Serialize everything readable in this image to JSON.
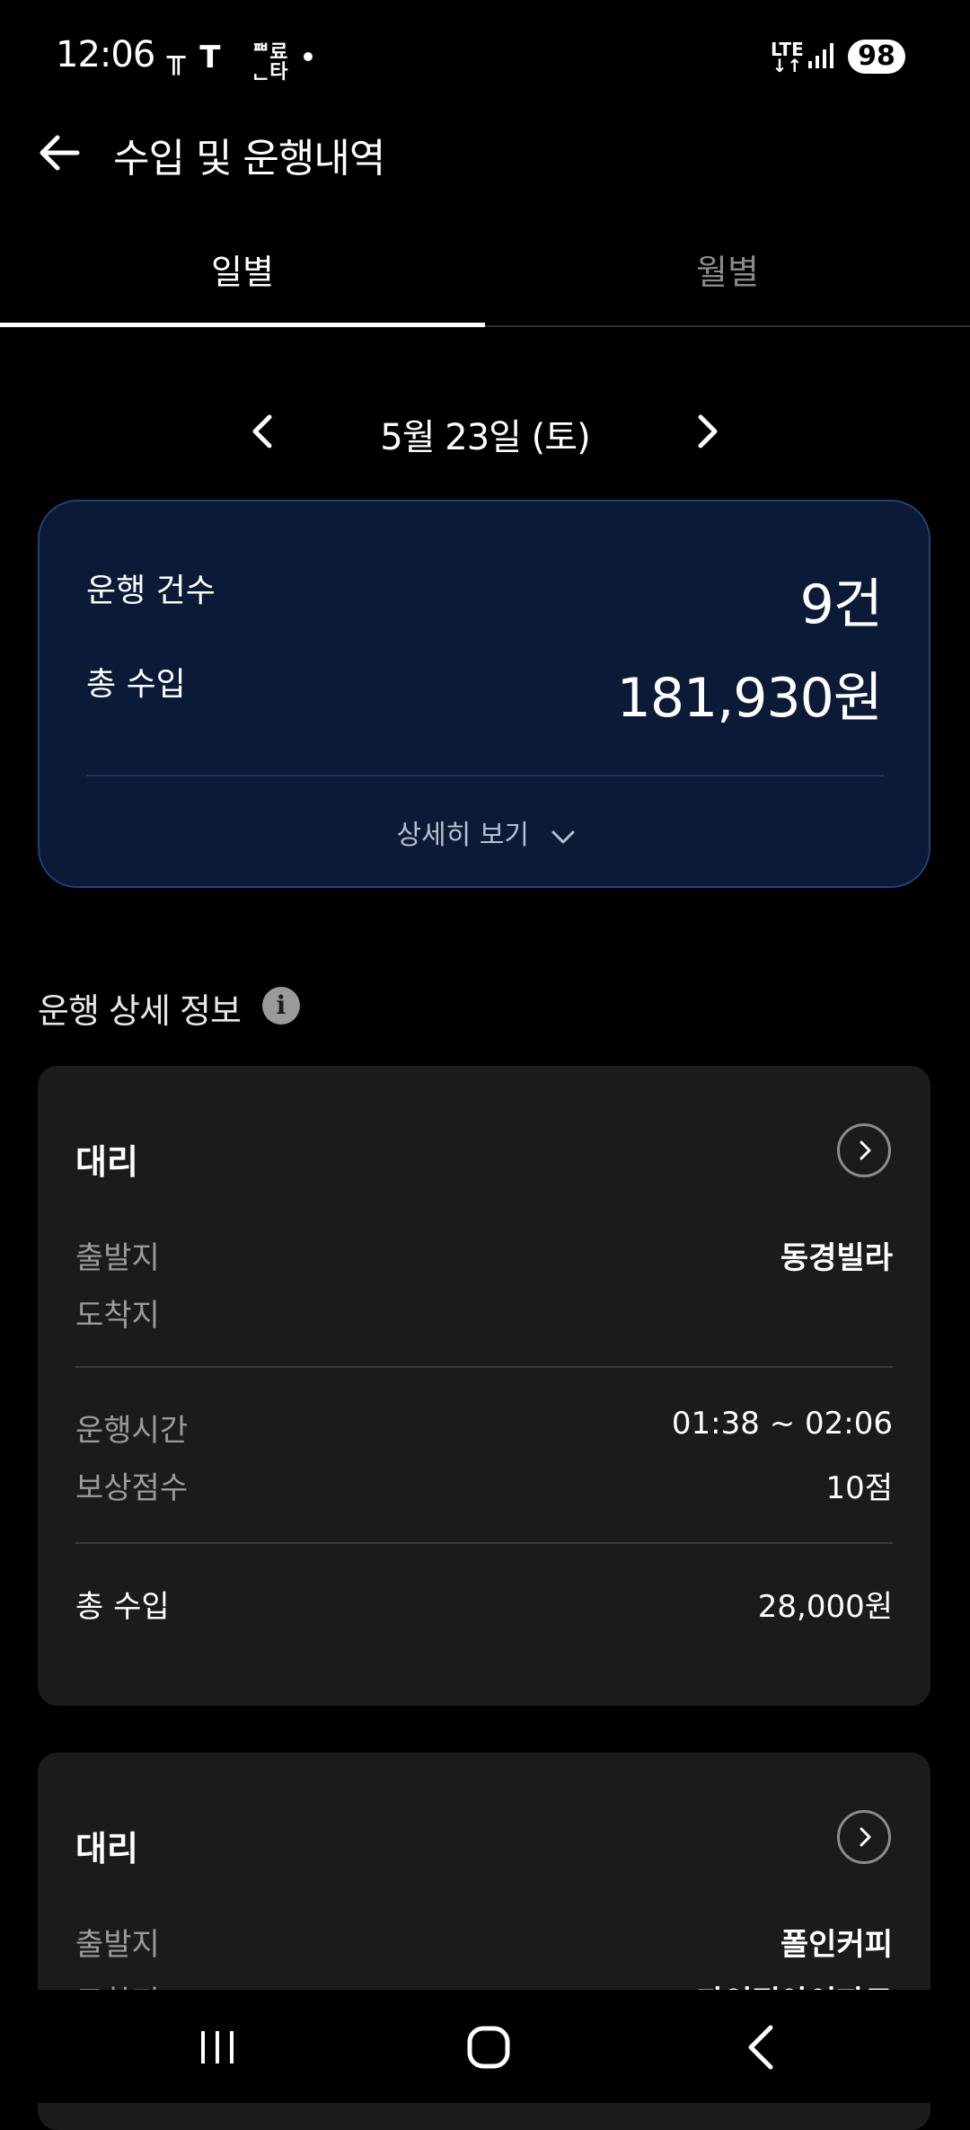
{
  "status_bar": {
    "time": "12:06",
    "carrier_icons": "╥ T",
    "carrier_small": "ᅖ료\nᆫ타",
    "network": "LTE",
    "network_arrows": "↓↑",
    "battery": "98"
  },
  "header": {
    "title": "수입 및 운행내역",
    "back_icon": "arrow-left-icon"
  },
  "tabs": [
    {
      "label": "일별",
      "active": true
    },
    {
      "label": "월별",
      "active": false
    }
  ],
  "date_nav": {
    "label": "5월 23일 (토)"
  },
  "summary": {
    "trips_label": "운행 건수",
    "trips_value": "9건",
    "income_label": "총 수입",
    "income_value": "181,930원",
    "detail_button": "상세히 보기"
  },
  "section": {
    "title": "운행 상세 정보",
    "info_icon": "i"
  },
  "rides": [
    {
      "type": "대리",
      "departure_label": "출발지",
      "departure": "동경빌라",
      "arrival_label": "도착지",
      "arrival": "",
      "time_label": "운행시간",
      "time": "01:38 ~ 02:06",
      "points_label": "보상점수",
      "points": "10점",
      "total_label": "총 수입",
      "total": "28,000원"
    },
    {
      "type": "대리",
      "departure_label": "출발지",
      "departure": "폴인커피",
      "arrival_label": "도착지",
      "arrival": "과인정아이파트"
    }
  ],
  "colors": {
    "background": "#000000",
    "summary_card": "#0b1a36",
    "summary_border": "#21407a",
    "ride_card": "#1b1b1b",
    "muted_text": "#9b9b9b"
  }
}
